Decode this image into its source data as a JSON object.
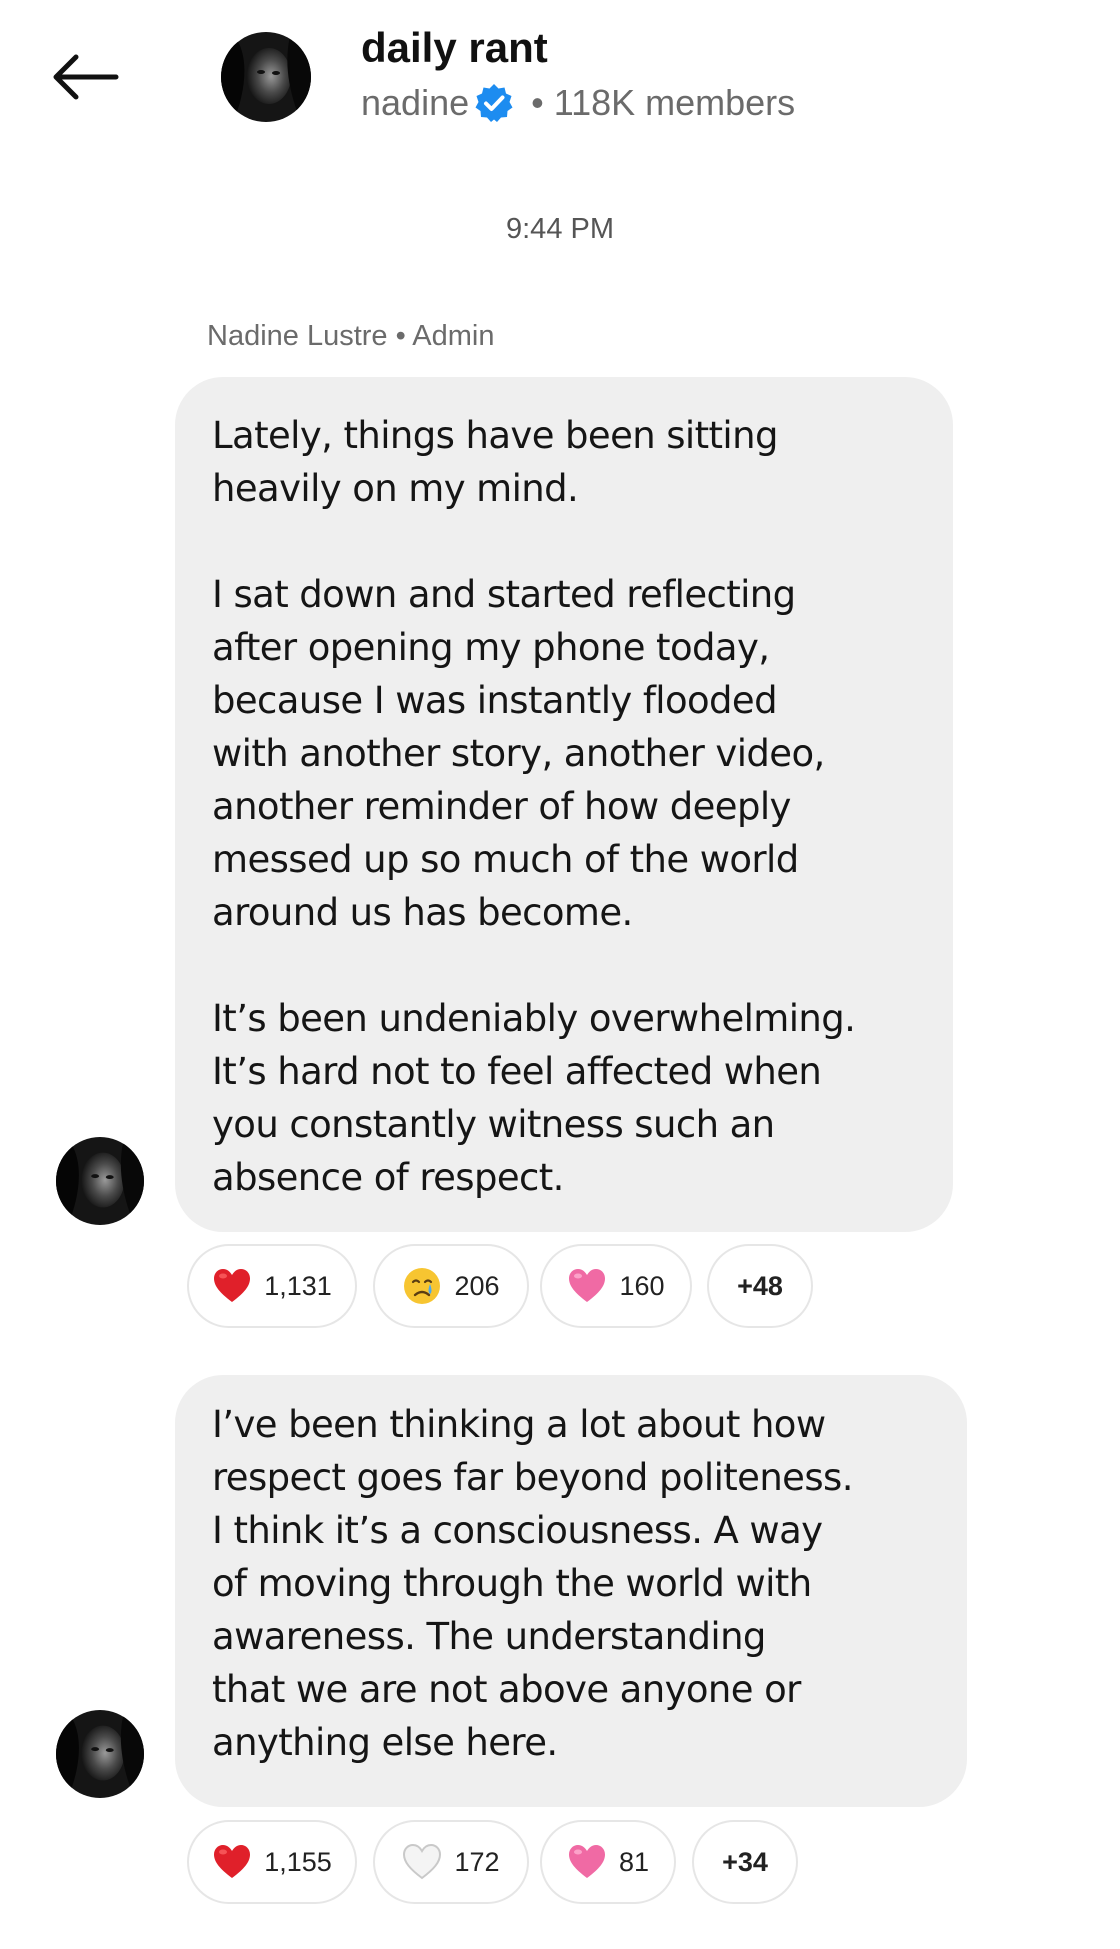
{
  "header": {
    "title": "daily rant",
    "owner": "nadine",
    "members": "118K members",
    "separator": "•"
  },
  "timestamp": "9:44 PM",
  "sender": {
    "name": "Nadine Lustre",
    "separator": "•",
    "role": "Admin"
  },
  "messages": [
    {
      "paragraphs": [
        "Lately, things have been sitting\nheavily on my mind.",
        "I sat down and started reflecting\nafter opening my phone today,\nbecause I was instantly flooded\nwith another story, another video,\nanother reminder of how deeply\nmessed up so much of the world\naround us has become.",
        "It’s been undeniably overwhelming.\nIt’s hard not to feel affected when\nyou constantly witness such an\nabsence of respect."
      ],
      "reactions": [
        {
          "icon": "red-heart-icon",
          "count": "1,131"
        },
        {
          "icon": "crying-face-icon",
          "count": "206"
        },
        {
          "icon": "pink-heart-icon",
          "count": "160"
        }
      ],
      "more": "+48"
    },
    {
      "paragraphs": [
        "I’ve been thinking a lot about how\nrespect goes far beyond politeness.\nI think it’s a consciousness. A way\nof moving through the world with\nawareness. The understanding\nthat we are not above anyone or\nanything else here."
      ],
      "reactions": [
        {
          "icon": "red-heart-icon",
          "count": "1,155"
        },
        {
          "icon": "white-heart-icon",
          "count": "172"
        },
        {
          "icon": "pink-heart-icon",
          "count": "81"
        }
      ],
      "more": "+34"
    }
  ],
  "colors": {
    "bubble": "#efefef",
    "verified": "#1d8cf0",
    "red_heart": "#e0202a",
    "pink_heart": "#f06aa4"
  }
}
